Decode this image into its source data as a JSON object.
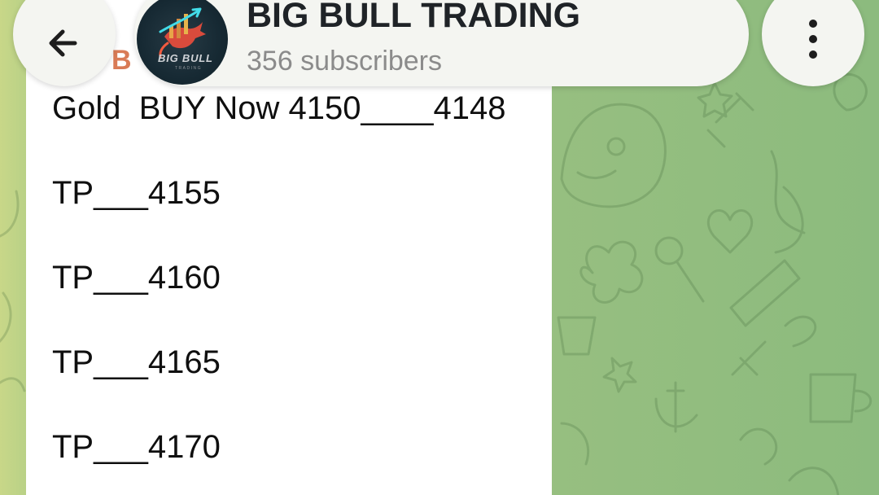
{
  "header": {
    "channel_name": "BIG BULL TRADING",
    "subscribers": "356 subscribers",
    "back_icon": "back-arrow-icon",
    "menu_icon": "more-vertical-icon",
    "avatar": {
      "main_text": "BIG BULL",
      "small_text": "TRADING"
    }
  },
  "message": {
    "sender_partial": "B",
    "lines": [
      "Gold  BUY Now 4150____4148",
      "TP___4155",
      "TP___4160",
      "TP___4165",
      "TP___4170"
    ]
  },
  "colors": {
    "wallpaper": "#8fbb7f",
    "message_bg": "#ffffff",
    "sender_name": "#d97b56",
    "header_bg": "#f4f5f1",
    "text": "#0f0f0f"
  }
}
